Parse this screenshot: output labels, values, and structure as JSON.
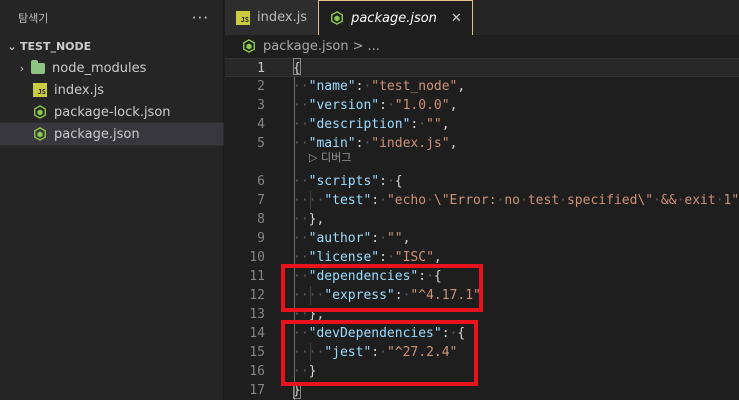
{
  "sidebar": {
    "title": "탐색기",
    "more_label": "···",
    "section": "TEST_NODE",
    "items": [
      {
        "label": "node_modules",
        "type": "folder"
      },
      {
        "label": "index.js",
        "type": "js"
      },
      {
        "label": "package-lock.json",
        "type": "node"
      },
      {
        "label": "package.json",
        "type": "node",
        "selected": true
      }
    ]
  },
  "tabs": [
    {
      "label": "index.js",
      "icon": "js-icon",
      "active": false
    },
    {
      "label": "package.json",
      "icon": "node-icon",
      "active": true,
      "close": "✕"
    }
  ],
  "breadcrumb": {
    "file": "package.json",
    "sep": ">",
    "rest": "..."
  },
  "editor": {
    "codelens": "▷ 디버그",
    "lines": [
      {
        "n": "1",
        "tokens": [
          [
            "p",
            "{"
          ]
        ]
      },
      {
        "n": "2",
        "tokens": [
          [
            "ws",
            "··"
          ],
          [
            "k",
            "\"name\""
          ],
          [
            "p",
            ":"
          ],
          [
            "ws",
            "·"
          ],
          [
            "s",
            "\"test_node\""
          ],
          [
            "p",
            ","
          ]
        ]
      },
      {
        "n": "3",
        "tokens": [
          [
            "ws",
            "··"
          ],
          [
            "k",
            "\"version\""
          ],
          [
            "p",
            ":"
          ],
          [
            "ws",
            "·"
          ],
          [
            "s",
            "\"1.0.0\""
          ],
          [
            "p",
            ","
          ]
        ]
      },
      {
        "n": "4",
        "tokens": [
          [
            "ws",
            "··"
          ],
          [
            "k",
            "\"description\""
          ],
          [
            "p",
            ":"
          ],
          [
            "ws",
            "·"
          ],
          [
            "s",
            "\"\""
          ],
          [
            "p",
            ","
          ]
        ]
      },
      {
        "n": "5",
        "tokens": [
          [
            "ws",
            "··"
          ],
          [
            "k",
            "\"main\""
          ],
          [
            "p",
            ":"
          ],
          [
            "ws",
            "·"
          ],
          [
            "s",
            "\"index.js\""
          ],
          [
            "p",
            ","
          ]
        ]
      },
      {
        "n": "6",
        "tokens": [
          [
            "ws",
            "··"
          ],
          [
            "k",
            "\"scripts\""
          ],
          [
            "p",
            ":"
          ],
          [
            "ws",
            "·"
          ],
          [
            "p",
            "{"
          ]
        ]
      },
      {
        "n": "7",
        "tokens": [
          [
            "ws",
            "····"
          ],
          [
            "k",
            "\"test\""
          ],
          [
            "p",
            ":"
          ],
          [
            "ws",
            "·"
          ],
          [
            "s",
            "\"echo"
          ],
          [
            "ws",
            "·"
          ],
          [
            "s",
            "\\\"Error:"
          ],
          [
            "ws",
            "·"
          ],
          [
            "s",
            "no"
          ],
          [
            "ws",
            "·"
          ],
          [
            "s",
            "test"
          ],
          [
            "ws",
            "·"
          ],
          [
            "s",
            "specified\\\""
          ],
          [
            "ws",
            "·"
          ],
          [
            "s",
            "&&"
          ],
          [
            "ws",
            "·"
          ],
          [
            "s",
            "exit"
          ],
          [
            "ws",
            "·"
          ],
          [
            "s",
            "1\""
          ]
        ]
      },
      {
        "n": "8",
        "tokens": [
          [
            "ws",
            "··"
          ],
          [
            "p",
            "},"
          ]
        ]
      },
      {
        "n": "9",
        "tokens": [
          [
            "ws",
            "··"
          ],
          [
            "k",
            "\"author\""
          ],
          [
            "p",
            ":"
          ],
          [
            "ws",
            "·"
          ],
          [
            "s",
            "\"\""
          ],
          [
            "p",
            ","
          ]
        ]
      },
      {
        "n": "10",
        "tokens": [
          [
            "ws",
            "··"
          ],
          [
            "k",
            "\"license\""
          ],
          [
            "p",
            ":"
          ],
          [
            "ws",
            "·"
          ],
          [
            "s",
            "\"ISC\""
          ],
          [
            "p",
            ","
          ]
        ]
      },
      {
        "n": "11",
        "tokens": [
          [
            "ws",
            "··"
          ],
          [
            "k",
            "\"dependencies\""
          ],
          [
            "p",
            ":"
          ],
          [
            "ws",
            "·"
          ],
          [
            "p",
            "{"
          ]
        ]
      },
      {
        "n": "12",
        "tokens": [
          [
            "ws",
            "····"
          ],
          [
            "k",
            "\"express\""
          ],
          [
            "p",
            ":"
          ],
          [
            "ws",
            "·"
          ],
          [
            "s",
            "\"^4.17.1\""
          ]
        ]
      },
      {
        "n": "13",
        "tokens": [
          [
            "ws",
            "··"
          ],
          [
            "p",
            "},"
          ]
        ]
      },
      {
        "n": "14",
        "tokens": [
          [
            "ws",
            "··"
          ],
          [
            "k",
            "\"devDependencies\""
          ],
          [
            "p",
            ":"
          ],
          [
            "ws",
            "·"
          ],
          [
            "p",
            "{"
          ]
        ]
      },
      {
        "n": "15",
        "tokens": [
          [
            "ws",
            "····"
          ],
          [
            "k",
            "\"jest\""
          ],
          [
            "p",
            ":"
          ],
          [
            "ws",
            "·"
          ],
          [
            "s",
            "\"^27.2.4\""
          ]
        ]
      },
      {
        "n": "16",
        "tokens": [
          [
            "ws",
            "··"
          ],
          [
            "p",
            "}"
          ]
        ]
      },
      {
        "n": "17",
        "tokens": [
          [
            "p",
            "}"
          ]
        ]
      }
    ]
  },
  "colors": {
    "highlight_box": "#e8131c",
    "key": "#9cdcfe",
    "string": "#ce9178",
    "js_badge": "#cbcb41",
    "node_badge": "#8cc84b"
  }
}
